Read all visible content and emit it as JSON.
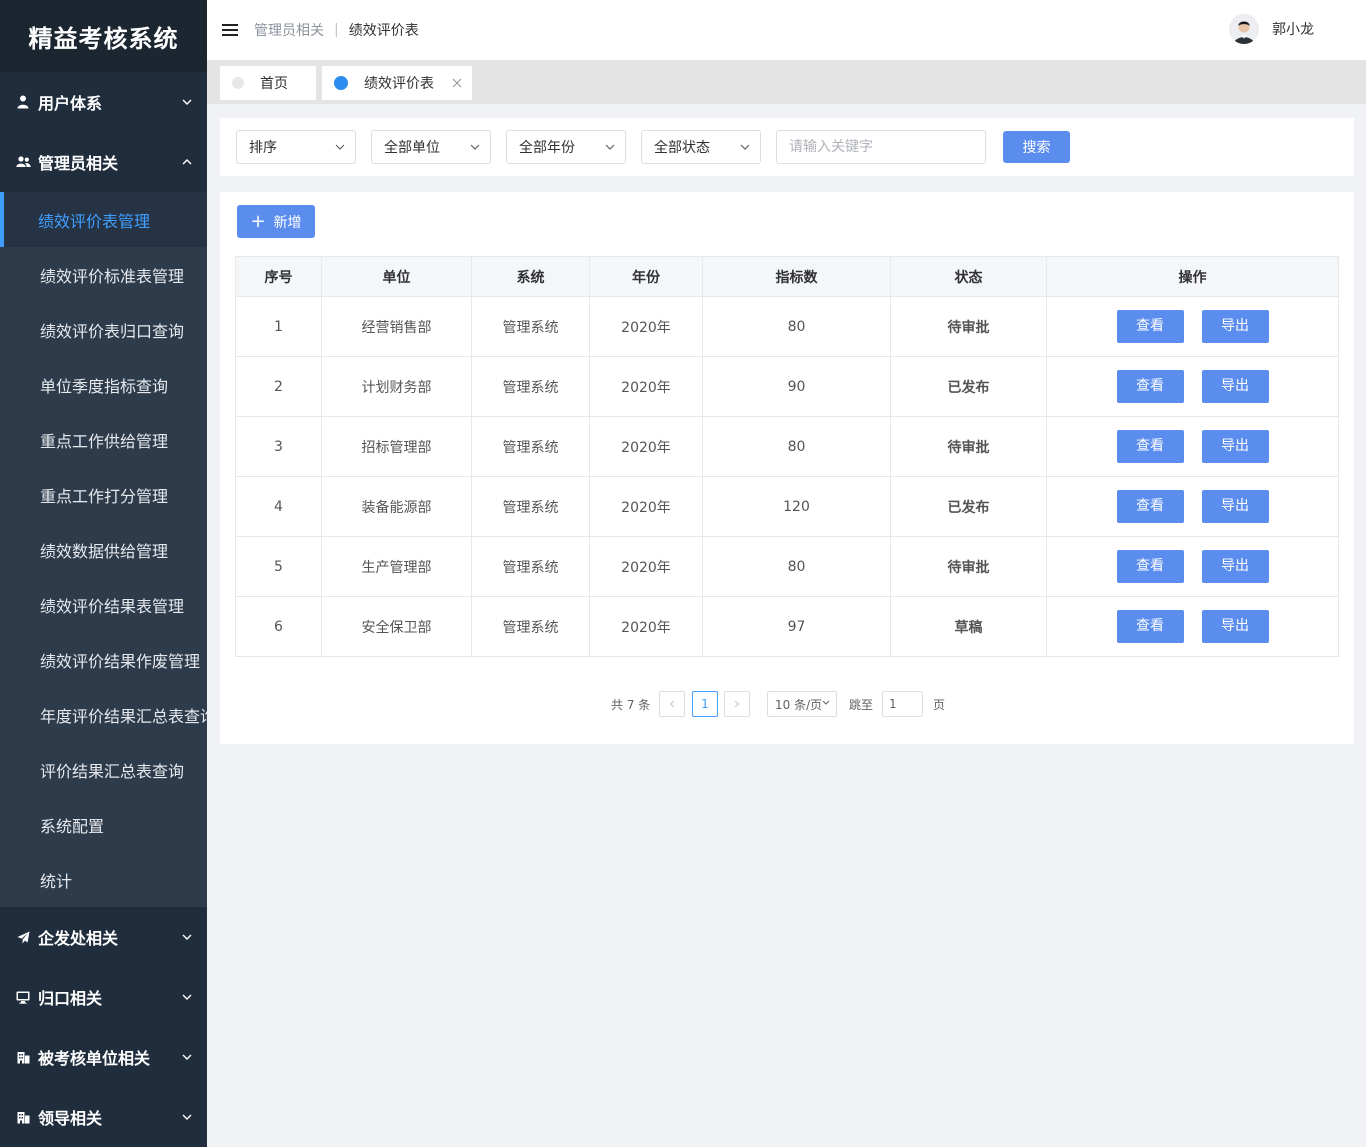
{
  "app": {
    "title": "精益考核系统"
  },
  "sidebar": {
    "groups": [
      {
        "label": "用户体系",
        "icon": "user-icon",
        "expanded": false
      },
      {
        "label": "管理员相关",
        "icon": "users-icon",
        "expanded": true
      },
      {
        "label": "企发处相关",
        "icon": "send-icon",
        "expanded": false
      },
      {
        "label": "归口相关",
        "icon": "monitor-icon",
        "expanded": false
      },
      {
        "label": "被考核单位相关",
        "icon": "building-icon",
        "expanded": false
      },
      {
        "label": "领导相关",
        "icon": "building-icon",
        "expanded": false
      }
    ],
    "admin_items": [
      {
        "label": "绩效评价表管理",
        "active": true
      },
      {
        "label": "绩效评价标准表管理"
      },
      {
        "label": "绩效评价表归口查询"
      },
      {
        "label": "单位季度指标查询"
      },
      {
        "label": "重点工作供给管理"
      },
      {
        "label": "重点工作打分管理"
      },
      {
        "label": "绩效数据供给管理"
      },
      {
        "label": "绩效评价结果表管理"
      },
      {
        "label": "绩效评价结果作废管理"
      },
      {
        "label": "年度评价结果汇总表查询"
      },
      {
        "label": "评价结果汇总表查询"
      },
      {
        "label": "系统配置"
      },
      {
        "label": "统计"
      }
    ]
  },
  "header": {
    "breadcrumb": [
      "管理员相关",
      "绩效评价表"
    ],
    "user": {
      "name": "郭小龙"
    }
  },
  "tabs": [
    {
      "label": "首页",
      "active": false
    },
    {
      "label": "绩效评价表",
      "active": true
    }
  ],
  "filters": {
    "sort": "排序",
    "unit": "全部单位",
    "year": "全部年份",
    "status": "全部状态",
    "keyword_placeholder": "请输入关键字",
    "keyword_value": "",
    "search_label": "搜索"
  },
  "actions": {
    "add_label": "新增"
  },
  "table": {
    "columns": [
      "序号",
      "单位",
      "系统",
      "年份",
      "指标数",
      "状态",
      "操作"
    ],
    "view_label": "查看",
    "export_label": "导出",
    "rows": [
      {
        "no": "1",
        "unit": "经营销售部",
        "system": "管理系统",
        "year": "2020年",
        "count": "80",
        "status": "待审批",
        "status_type": "pending"
      },
      {
        "no": "2",
        "unit": "计划财务部",
        "system": "管理系统",
        "year": "2020年",
        "count": "90",
        "status": "已发布",
        "status_type": "published"
      },
      {
        "no": "3",
        "unit": "招标管理部",
        "system": "管理系统",
        "year": "2020年",
        "count": "80",
        "status": "待审批",
        "status_type": "pending"
      },
      {
        "no": "4",
        "unit": "装备能源部",
        "system": "管理系统",
        "year": "2020年",
        "count": "120",
        "status": "已发布",
        "status_type": "published"
      },
      {
        "no": "5",
        "unit": "生产管理部",
        "system": "管理系统",
        "year": "2020年",
        "count": "80",
        "status": "待审批",
        "status_type": "pending"
      },
      {
        "no": "6",
        "unit": "安全保卫部",
        "system": "管理系统",
        "year": "2020年",
        "count": "97",
        "status": "草稿",
        "status_type": "draft"
      }
    ]
  },
  "pagination": {
    "total_text": "共 7 条",
    "current_page": "1",
    "page_size": "10 条/页",
    "jump_label": "跳至",
    "jump_value": "1",
    "jump_suffix": "页"
  },
  "colors": {
    "sidebar_bg": "#1f2d3d",
    "submenu_bg": "#2e3b4b",
    "accent": "#409eff",
    "primary_button": "#5b8def",
    "status_pending": "#e02424",
    "status_published": "#2f8a2f"
  }
}
